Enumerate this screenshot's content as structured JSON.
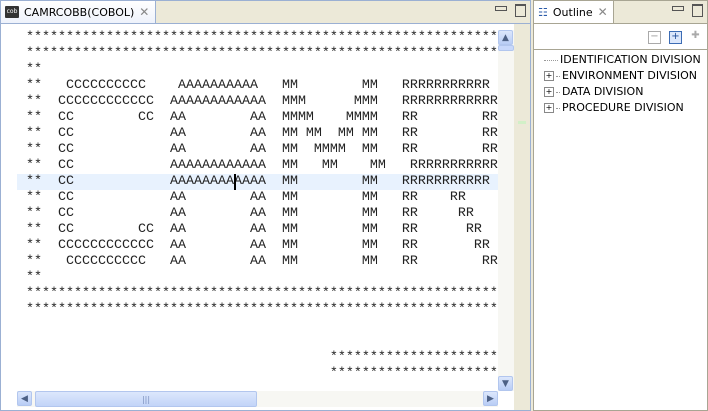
{
  "editor": {
    "tab_title": "CAMRCOBB(COBOL)",
    "tab_icon": "cob-file-icon",
    "current_line": 8,
    "lines": [
      "************************************************************************",
      "************************************************************************",
      "**",
      "**   CCCCCCCCCC    AAAAAAAAAA   MM        MM   RRRRRRRRRRR",
      "**  CCCCCCCCCCCC  AAAAAAAAAAAA  MMM      MMM   RRRRRRRRRRRR",
      "**  CC        CC  AA        AA  MMMM    MMMM   RR        RR",
      "**  CC            AA        AA  MM MM  MM MM   RR        RR",
      "**  CC            AA        AA  MM  MMMM  MM   RR        RR",
      "**  CC            AAAAAAAAAAAA  MM   MM    MM   RRRRRRRRRRRR",
      "**  CC            AAAAAAAAAAAA  MM        MM   RRRRRRRRRRR",
      "**  CC            AA        AA  MM        MM   RR    RR",
      "**  CC            AA        AA  MM        MM   RR     RR",
      "**  CC        CC  AA        AA  MM        MM   RR      RR",
      "**  CCCCCCCCCCCC  AA        AA  MM        MM   RR       RR",
      "**   CCCCCCCCCC   AA        AA  MM        MM   RR        RR",
      "**",
      "************************************************************************",
      "************************************************************************",
      "",
      "",
      "                                      **********************************",
      "                                      **********************************"
    ]
  },
  "outline": {
    "tab_title": "Outline",
    "tab_icon": "outline-icon",
    "toolbar": [
      "collapse-all-icon",
      "expand-all-icon",
      "add-icon"
    ],
    "items": [
      {
        "label": "IDENTIFICATION DIVISION",
        "expandable": false
      },
      {
        "label": "ENVIRONMENT DIVISION",
        "expandable": true
      },
      {
        "label": "DATA DIVISION",
        "expandable": true
      },
      {
        "label": "PROCEDURE DIVISION",
        "expandable": true
      }
    ]
  }
}
